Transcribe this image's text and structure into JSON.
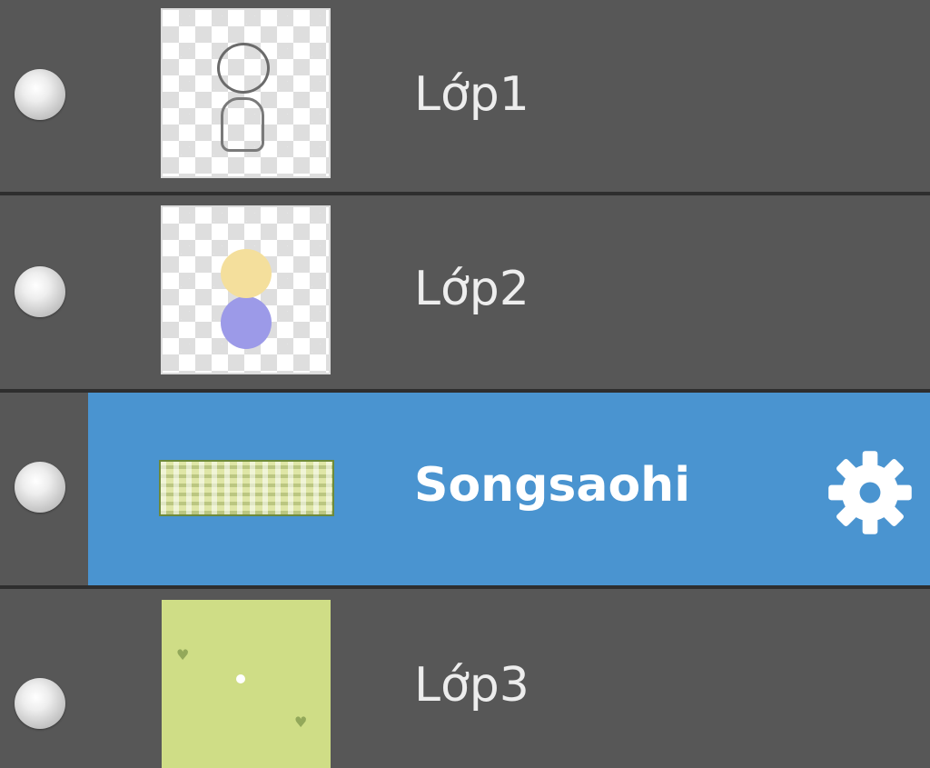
{
  "layers": [
    {
      "name": "Lớp1",
      "selected": false,
      "thumbnail": "sketch-figure"
    },
    {
      "name": "Lớp2",
      "selected": false,
      "thumbnail": "colored-figure"
    },
    {
      "name": "Songsaohi",
      "selected": true,
      "thumbnail": "pattern-strip",
      "settings_icon": "gear-icon"
    },
    {
      "name": "Lớp3",
      "selected": false,
      "thumbnail": "green-background"
    }
  ],
  "colors": {
    "panel_background": "#575757",
    "selected_row": "#4a94d0",
    "separator": "#2e2e2e",
    "text": "#ededed"
  }
}
